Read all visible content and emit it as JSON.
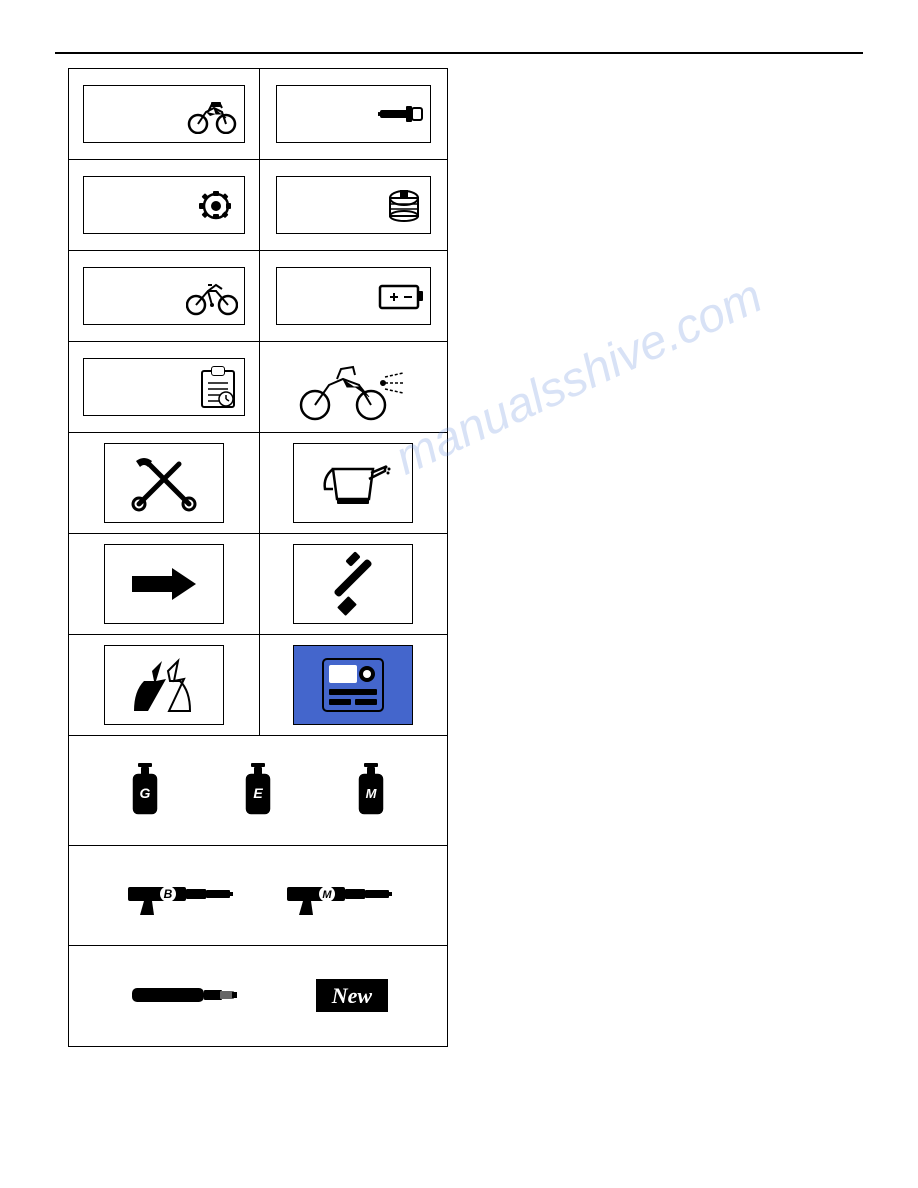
{
  "page": {
    "watermark": "manualsshive.com",
    "table": {
      "rows": [
        {
          "type": "icon-pair",
          "left": {
            "icon": "motorcycle"
          },
          "right": {
            "icon": "micrometer"
          }
        },
        {
          "type": "icon-pair",
          "left": {
            "icon": "wrench-gear"
          },
          "right": {
            "icon": "filter"
          }
        },
        {
          "type": "icon-pair",
          "left": {
            "icon": "bicycle"
          },
          "right": {
            "icon": "battery"
          }
        },
        {
          "type": "icon-pair",
          "left": {
            "icon": "checklist"
          },
          "right": {
            "icon": "motorcycle-spray"
          }
        },
        {
          "type": "square-pair",
          "left": {
            "icon": "tools-cross"
          },
          "right": {
            "icon": "watering-can"
          }
        },
        {
          "type": "square-pair",
          "left": {
            "icon": "arrow-right"
          },
          "right": {
            "icon": "screwdriver"
          }
        },
        {
          "type": "square-pair",
          "left": {
            "icon": "hands-lightning"
          },
          "right": {
            "icon": "measurement-device"
          }
        },
        {
          "type": "lube-row",
          "items": [
            {
              "label": "G",
              "icon": "oil-can-g"
            },
            {
              "label": "E",
              "icon": "oil-can-e"
            },
            {
              "label": "M",
              "icon": "oil-can-m"
            }
          ]
        },
        {
          "type": "grease-row",
          "items": [
            {
              "label": "B",
              "icon": "grease-gun-b"
            },
            {
              "label": "M",
              "icon": "grease-gun-m"
            }
          ]
        },
        {
          "type": "new-row",
          "items": [
            {
              "icon": "pen-marker"
            },
            {
              "label": "New"
            }
          ]
        }
      ]
    }
  }
}
